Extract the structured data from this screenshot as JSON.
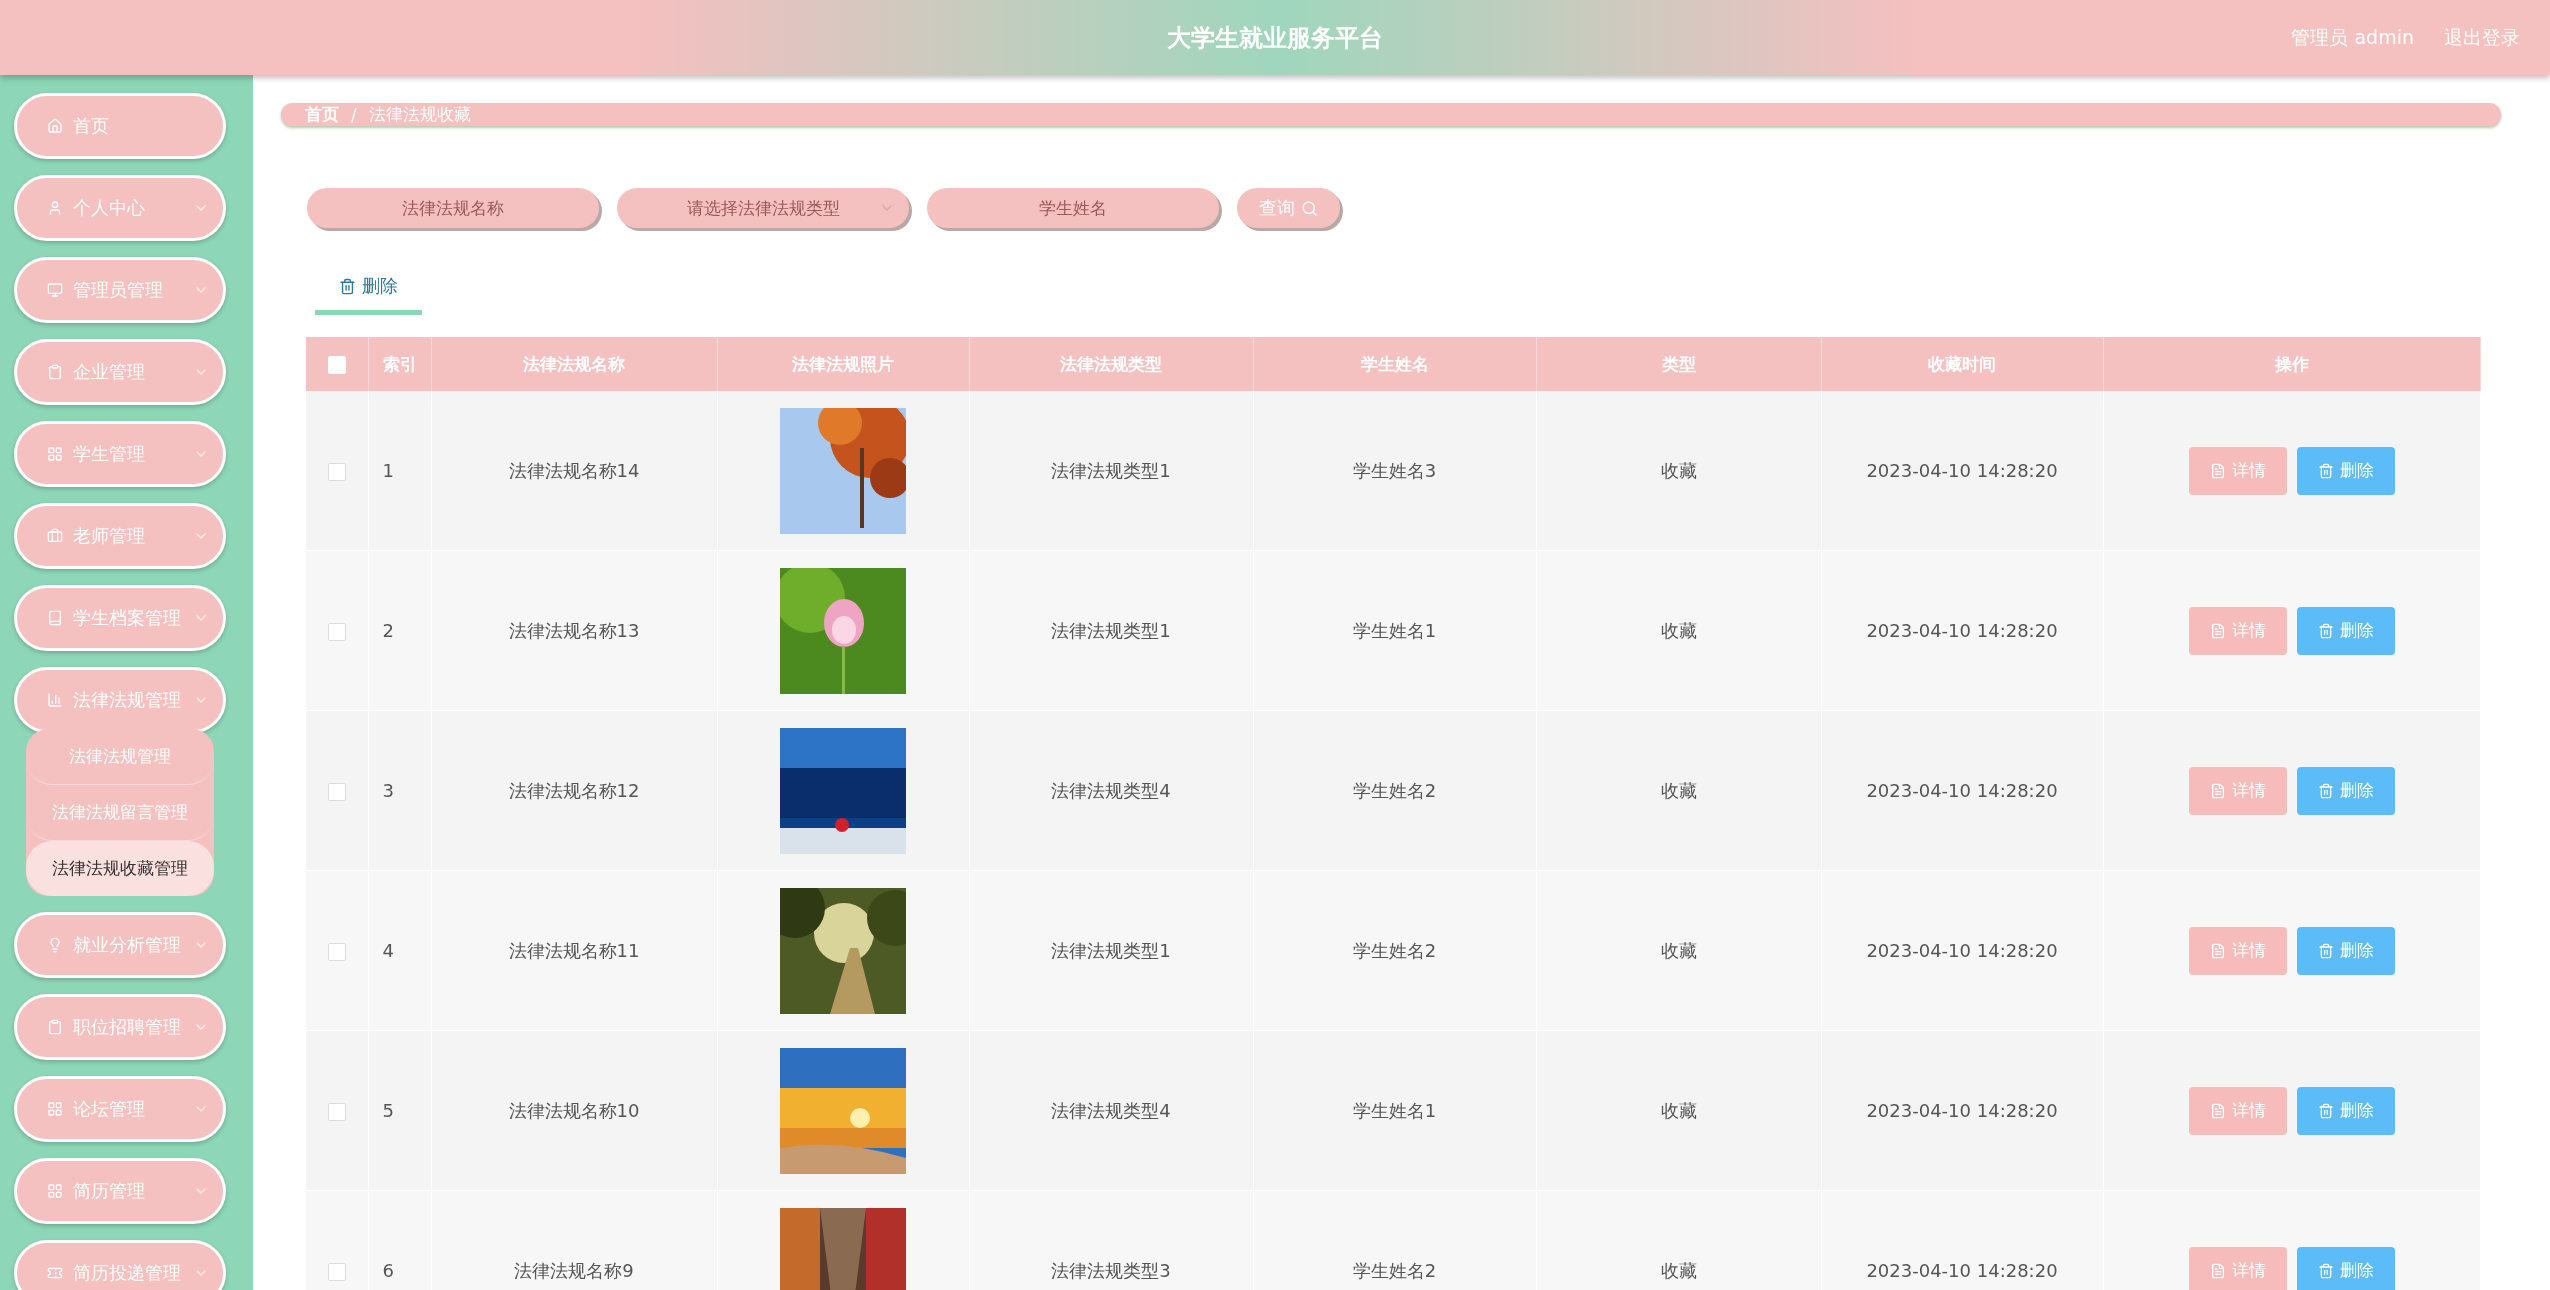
{
  "header": {
    "title": "大学生就业服务平台",
    "user": "管理员 admin",
    "logout": "退出登录"
  },
  "sidebar": {
    "items": [
      {
        "label": "首页"
      },
      {
        "label": "个人中心"
      },
      {
        "label": "管理员管理"
      },
      {
        "label": "企业管理"
      },
      {
        "label": "学生管理"
      },
      {
        "label": "老师管理"
      },
      {
        "label": "学生档案管理"
      },
      {
        "label": "法律法规管理",
        "expanded": true,
        "children": [
          {
            "label": "法律法规管理",
            "selected": false
          },
          {
            "label": "法律法规留言管理",
            "selected": false
          },
          {
            "label": "法律法规收藏管理",
            "selected": true
          }
        ]
      },
      {
        "label": "就业分析管理"
      },
      {
        "label": "职位招聘管理"
      },
      {
        "label": "论坛管理"
      },
      {
        "label": "简历管理"
      },
      {
        "label": "简历投递管理"
      }
    ]
  },
  "breadcrumb": [
    "首页",
    "/",
    "法律法规收藏"
  ],
  "search": {
    "fields": [
      {
        "kind": "input",
        "placeholder": "法律法规名称"
      },
      {
        "kind": "select",
        "placeholder": "请选择法律法规类型"
      },
      {
        "kind": "input",
        "placeholder": "学生姓名"
      }
    ],
    "button": "查询"
  },
  "actions": [
    {
      "label": "删除",
      "selected": true
    }
  ],
  "table": {
    "select_all_checked": false,
    "columns": [
      "索引",
      "法律法规名称",
      "法律法规照片",
      "法律法规类型",
      "学生姓名",
      "类型",
      "收藏时间",
      "操作"
    ],
    "rows": [
      {
        "checked": false,
        "index": "1",
        "name": "法律法规名称14",
        "type": "法律法规类型1",
        "student": "学生姓名3",
        "kind": "收藏",
        "time": "2023-04-10 14:28:20",
        "detail": "详情",
        "delete": "删除"
      },
      {
        "checked": false,
        "index": "2",
        "name": "法律法规名称13",
        "type": "法律法规类型1",
        "student": "学生姓名1",
        "kind": "收藏",
        "time": "2023-04-10 14:28:20",
        "detail": "详情",
        "delete": "删除"
      },
      {
        "checked": false,
        "index": "3",
        "name": "法律法规名称12",
        "type": "法律法规类型4",
        "student": "学生姓名2",
        "kind": "收藏",
        "time": "2023-04-10 14:28:20",
        "detail": "详情",
        "delete": "删除"
      },
      {
        "checked": false,
        "index": "4",
        "name": "法律法规名称11",
        "type": "法律法规类型1",
        "student": "学生姓名2",
        "kind": "收藏",
        "time": "2023-04-10 14:28:20",
        "detail": "详情",
        "delete": "删除"
      },
      {
        "checked": false,
        "index": "5",
        "name": "法律法规名称10",
        "type": "法律法规类型4",
        "student": "学生姓名1",
        "kind": "收藏",
        "time": "2023-04-10 14:28:20",
        "detail": "详情",
        "delete": "删除"
      },
      {
        "checked": false,
        "index": "6",
        "name": "法律法规名称9",
        "type": "法律法规类型3",
        "student": "学生姓名2",
        "kind": "收藏",
        "time": "2023-04-10 14:28:20",
        "detail": "详情",
        "delete": "删除"
      }
    ]
  }
}
